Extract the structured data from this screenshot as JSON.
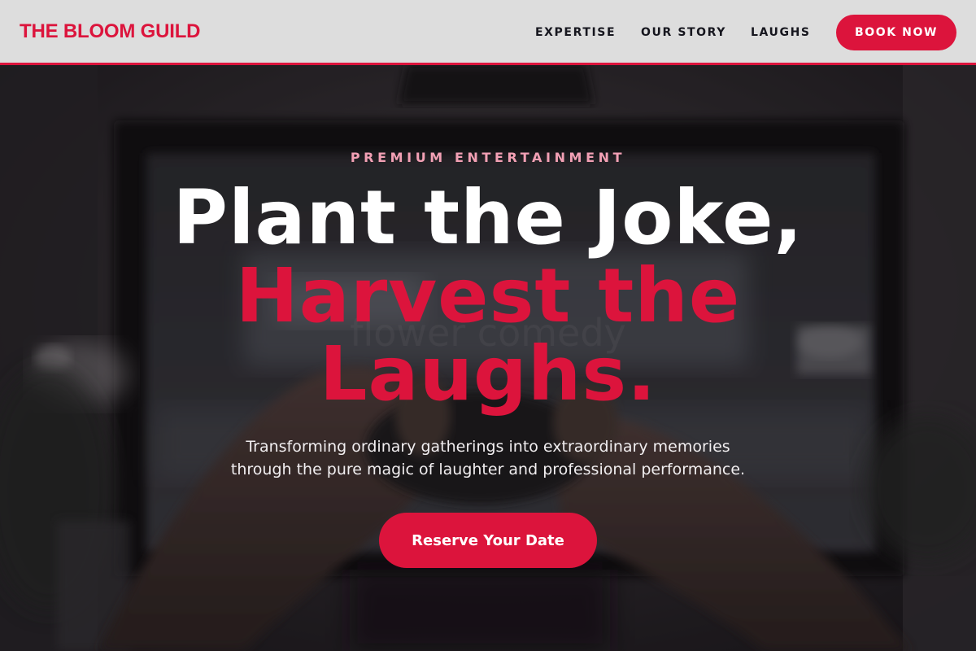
{
  "header": {
    "brand": "THE BLOOM GUILD",
    "nav": [
      "EXPERTISE",
      "OUR STORY",
      "LAUGHS"
    ],
    "book_button": "BOOK NOW"
  },
  "hero": {
    "eyebrow": "PREMIUM ENTERTAINMENT",
    "headline_line1": "Plant the Joke,",
    "headline_line2": "Harvest the",
    "headline_line3": "Laughs.",
    "subtext_line1": "Transforming ordinary gatherings into extraordinary memories",
    "subtext_line2": "through the pure magic of laughter and professional performance.",
    "cta_label": "Reserve Your Date",
    "background_image": "person-holding-game-controller-photo"
  },
  "colors": {
    "accent": "#dc143c",
    "header_bg": "#dddddd",
    "nav_text": "#16161e",
    "eyebrow": "#f2a0b4"
  }
}
